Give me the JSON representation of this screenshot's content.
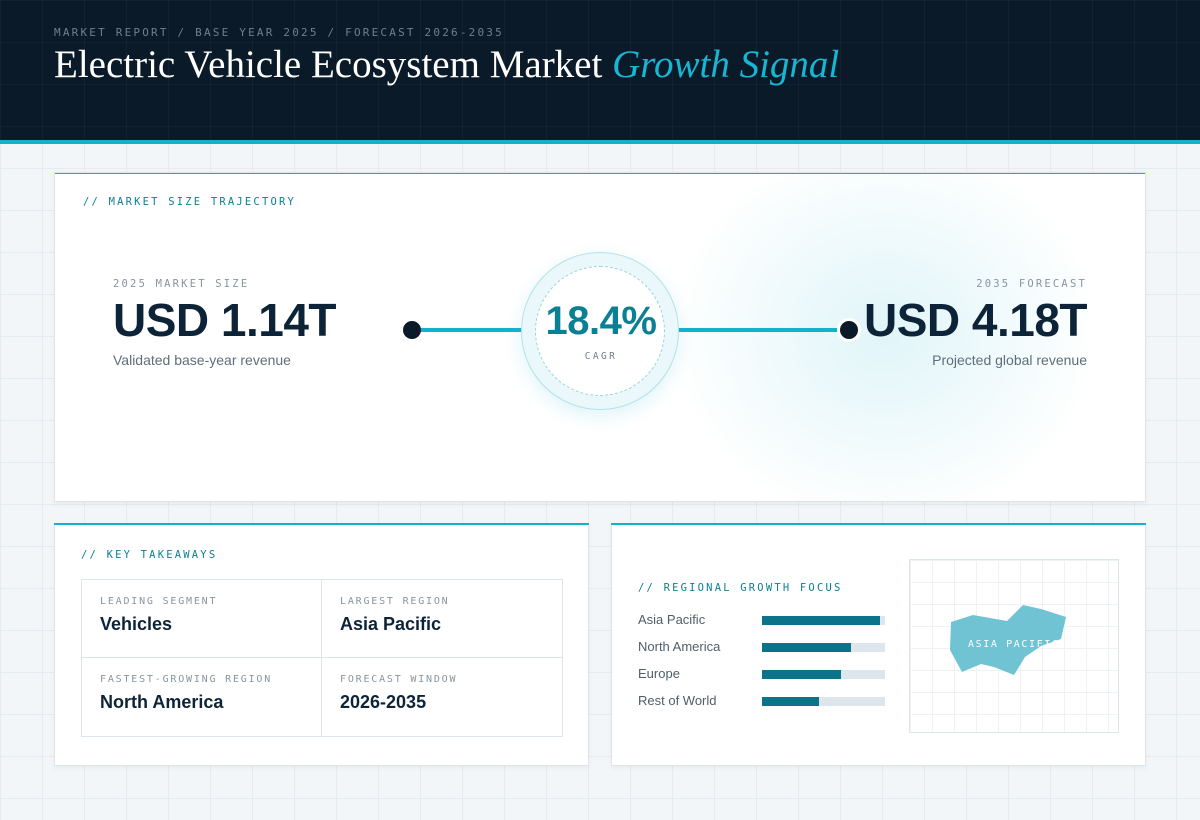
{
  "header": {
    "breadcrumb": "MARKET REPORT / BASE YEAR 2025 / FORECAST 2026-2035",
    "title_main": "Electric Vehicle Ecosystem Market",
    "title_accent": "Growth Signal"
  },
  "trajectory": {
    "label": "// MARKET SIZE TRAJECTORY",
    "start": {
      "caption": "2025 MARKET SIZE",
      "value": "USD 1.14T",
      "description": "Validated base-year revenue"
    },
    "cagr": {
      "value": "18.4%",
      "caption": "CAGR"
    },
    "end": {
      "caption": "2035 FORECAST",
      "value": "USD 4.18T",
      "description": "Projected global revenue"
    }
  },
  "takeaways": {
    "label": "// KEY TAKEAWAYS",
    "items": [
      {
        "caption": "LEADING SEGMENT",
        "value": "Vehicles"
      },
      {
        "caption": "LARGEST REGION",
        "value": "Asia Pacific"
      },
      {
        "caption": "FASTEST-GROWING REGION",
        "value": "North America"
      },
      {
        "caption": "FORECAST WINDOW",
        "value": "2026-2035"
      }
    ]
  },
  "regional": {
    "label": "// REGIONAL GROWTH FOCUS",
    "regions": [
      {
        "name": "Asia Pacific",
        "share": 0.96
      },
      {
        "name": "North America",
        "share": 0.72
      },
      {
        "name": "Europe",
        "share": 0.64
      },
      {
        "name": "Rest of World",
        "share": 0.46
      }
    ],
    "map_label": "ASIA PACIFIC",
    "map_color": "#6fc3d2"
  },
  "colors": {
    "accent": "#12b2cc",
    "accent_dark": "#0b7f93",
    "navy": "#0a1a28",
    "bar_fill": "#0b7488"
  }
}
